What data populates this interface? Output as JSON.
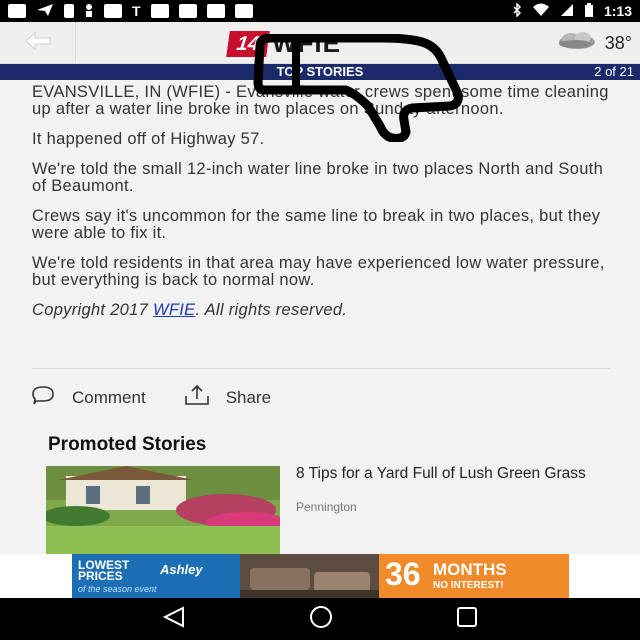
{
  "status_bar": {
    "time": "1:13",
    "icons": [
      "notification-icon",
      "send-icon",
      "facebook-icon",
      "person-icon",
      "message-icon",
      "t-icon",
      "bluetooth-icon",
      "wifi-icon",
      "signal-icon",
      "battery-icon"
    ]
  },
  "app_bar": {
    "logo_number": "14",
    "logo_text": "WFIE",
    "weather_temp": "38°"
  },
  "section": {
    "title": "TOP STORIES",
    "count": "2 of 21",
    "color": "#1b2a6b"
  },
  "article": {
    "paragraphs": [
      "EVANSVILLE, IN (WFIE) - Evansville water crews spent some time cleaning up after a water line broke in two places on Sunday afternoon.",
      "It happened off of Highway 57.",
      "We're told the small 12-inch water line broke in two places North and South of Beaumont.",
      "Crews say it's uncommon for the same line to break in two places, but they were able to fix it.",
      "We're told residents in that area may have experienced low water pressure, but everything is back to normal now."
    ],
    "copyright_prefix": "Copyright 2017 ",
    "copyright_link": "WFIE",
    "copyright_suffix": ". All rights reserved."
  },
  "actions": {
    "comment_label": "Comment",
    "share_label": "Share"
  },
  "promoted": {
    "title": "Promoted Stories",
    "items": [
      {
        "headline": "8 Tips for a Yard Full of Lush Green Grass",
        "source": "Pennington"
      }
    ]
  },
  "ad": {
    "lowest_prices": "LOWEST PRICES",
    "brand": "Ashley",
    "sub": "of the season event",
    "number": "36",
    "months": "MONTHS",
    "interest": "NO INTEREST!"
  }
}
